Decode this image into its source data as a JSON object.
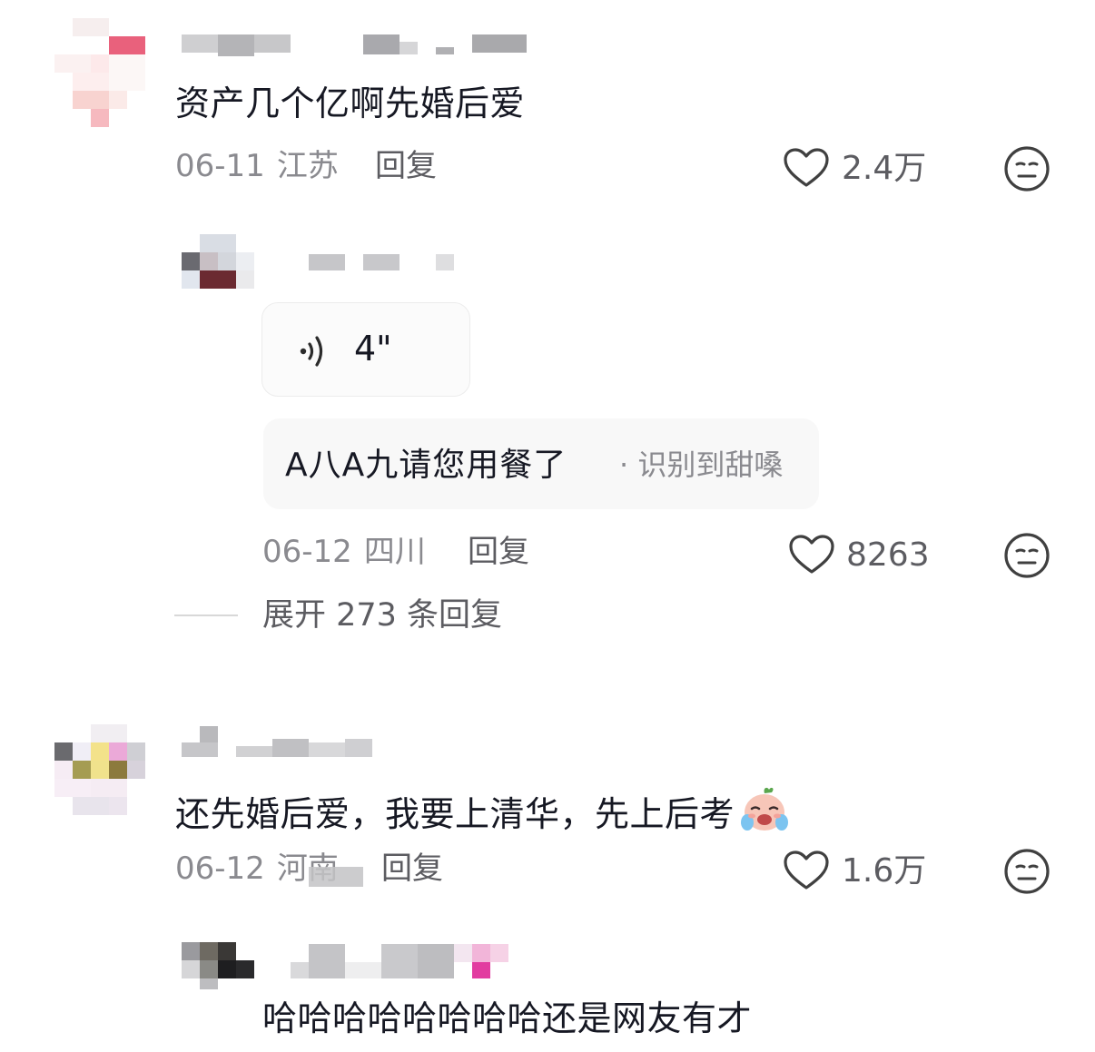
{
  "comments": [
    {
      "text": "资产几个亿啊先婚后爱",
      "date": "06-11",
      "location": "江苏",
      "reply_label": "回复",
      "likes": "2.4万",
      "reply": {
        "voice_duration": "4\"",
        "transcript": "A八A九请您用餐了",
        "transcript_suffix": "· 识别到甜嗓",
        "date": "06-12",
        "location": "四川",
        "reply_label": "回复",
        "likes": "8263"
      },
      "expand_label": "展开 273 条回复"
    },
    {
      "text": "还先婚后爱，我要上清华，先上后考",
      "date": "06-12",
      "location": "河南",
      "reply_label": "回复",
      "likes": "1.6万",
      "reply": {
        "text": "哈哈哈哈哈哈哈哈还是网友有才"
      }
    }
  ],
  "icons": {
    "like": "heart-outline-icon",
    "dislike": "unamused-face-icon",
    "voice": "sound-wave-icon",
    "emoji": "laughing-crying-face-emoji"
  },
  "colors": {
    "text_primary": "#161823",
    "text_meta": "#8a8a8f",
    "icon_stroke": "#404040"
  }
}
